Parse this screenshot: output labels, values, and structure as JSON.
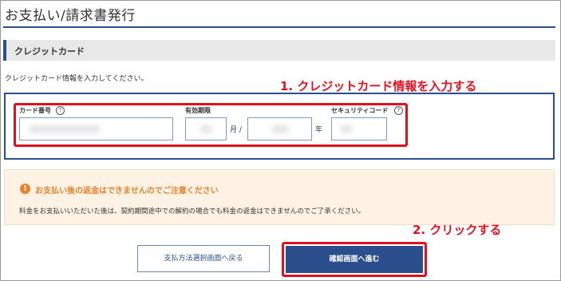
{
  "page": {
    "title": "お支払い/請求書発行"
  },
  "section": {
    "title": "クレジットカード"
  },
  "instruction": "クレジットカード情報を入力してください。",
  "annotations": {
    "step1": "1. クレジットカード情報を入力する",
    "step2": "2. クリックする",
    "color": "#e0101f"
  },
  "card_form": {
    "card_number": {
      "label": "カード番号",
      "help_icon": "question-circle-icon",
      "value": ""
    },
    "expiry": {
      "label": "有効期限",
      "month_value": "",
      "month_unit": "月 /",
      "year_value": "",
      "year_unit": "年"
    },
    "security_code": {
      "label": "セキュリティコード",
      "help_icon": "question-circle-icon",
      "value": ""
    }
  },
  "warning": {
    "icon": "exclamation-circle-icon",
    "title": "お支払い後の返金はできませんのでご注意ください",
    "body": "料金をお支払いいただいた後は、契約期間途中での解約の場合でも料金の返金はできませんのでご了承ください。",
    "color": "#e8832a"
  },
  "buttons": {
    "back": "支払方法選択画面へ戻る",
    "next": "確認画面へ進む"
  },
  "colors": {
    "accent": "#2b4f8c",
    "warning_bg": "#fdf2e4"
  }
}
